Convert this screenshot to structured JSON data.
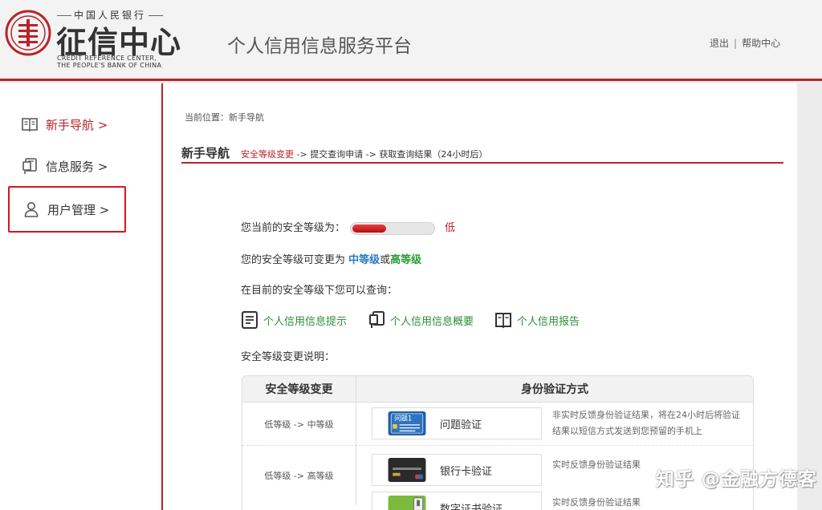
{
  "header": {
    "logo_top": "中国人民银行",
    "logo_main": "征信中心",
    "logo_en_1": "CREDIT REFERENCE CENTER,",
    "logo_en_2": "THE PEOPLE'S BANK OF CHINA",
    "site_title": "个人信用信息服务平台",
    "logout": "退出",
    "separator": "|",
    "help": "帮助中心"
  },
  "sidebar": {
    "items": [
      {
        "label": "新手导航 >",
        "icon": "book-icon"
      },
      {
        "label": "信息服务 >",
        "icon": "document-icon"
      },
      {
        "label": "用户管理 >",
        "icon": "user-icon"
      }
    ]
  },
  "content": {
    "breadcrumb": "当前位置：新手导航",
    "title": "新手导航",
    "steps": {
      "current": "安全等级变更",
      "rest": " -> 提交查询申请 -> 获取查询结果（24小时后）"
    },
    "security": {
      "label": "您当前的安全等级为：",
      "level_fraction": 0.4,
      "level_text": "低",
      "change_prefix": "您的安全等级可变更为 ",
      "mid": "中等级",
      "or": "或",
      "high": "高等级",
      "query_prompt": "在目前的安全等级下您可以查询："
    },
    "links": [
      {
        "label": "个人信用信息提示",
        "icon": "list-doc-icon"
      },
      {
        "label": "个人信用信息概要",
        "icon": "document-icon"
      },
      {
        "label": "个人信用报告",
        "icon": "book-icon"
      }
    ],
    "change_note": "安全等级变更说明：",
    "table": {
      "headers": [
        "安全等级变更",
        "身份验证方式"
      ],
      "rows": [
        {
          "change": "低等级 -> 中等级",
          "methods": [
            {
              "label": "问题验证",
              "thumb_text": "问题1",
              "desc": "非实时反馈身份验证结果，将在24小时后将验证结果以短信方式发送到您预留的手机上"
            }
          ]
        },
        {
          "change": "低等级 -> 高等级",
          "methods": [
            {
              "label": "银行卡验证",
              "desc": "实时反馈身份验证结果"
            },
            {
              "label": "数字证书验证",
              "desc": "实时反馈身份验证结果"
            }
          ]
        }
      ]
    }
  },
  "watermark": "知乎 @金融方德客",
  "colors": {
    "brand_red": "#b8242a",
    "link_green": "#2e8f38",
    "mid_blue": "#2b7cc2"
  }
}
